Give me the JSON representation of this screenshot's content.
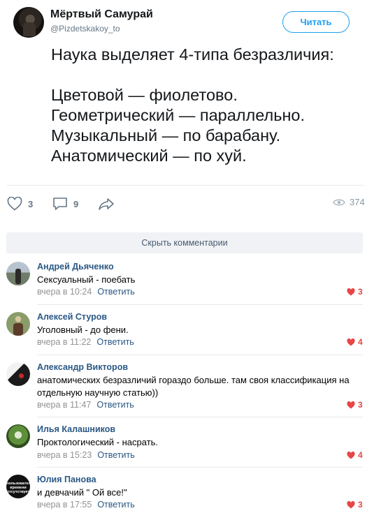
{
  "tweet": {
    "author_name": "Мёртвый Самурай",
    "author_handle": "@Pizdetskakoy_to",
    "follow_label": "Читать",
    "text_lines": [
      "Наука выделяет 4-типа безразличия:",
      "",
      "Цветовой — фиолетово.",
      "Геометрический — параллельно.",
      "Музыкальный — по барабану.",
      "Анатомический — по хуй."
    ],
    "likes": "3",
    "replies": "9",
    "views": "374",
    "icons": {
      "like": "heart-outline-icon",
      "reply": "comment-bubble-icon",
      "share": "share-arrow-icon",
      "views": "eye-icon"
    }
  },
  "comments_toggle_label": "Скрыть комментарии",
  "reply_label": "Ответить",
  "colors": {
    "link": "#2a5885",
    "like": "#e64646",
    "twitter_blue": "#1da1f2",
    "meta_gray": "#939393"
  },
  "comments": [
    {
      "author": "Андрей Дьяченко",
      "text": "Сексуальный - поебать",
      "time": "вчера в 10:24",
      "likes": "3"
    },
    {
      "author": "Алексей Стуров",
      "text": "Уголовный - до фени.",
      "time": "вчера в 11:22",
      "likes": "4"
    },
    {
      "author": "Александр Викторов",
      "text": "анатомических безразличий гораздо больше. там своя классификация на отдельную научную статью))",
      "time": "вчера в 11:47",
      "likes": "3"
    },
    {
      "author": "Илья Калашников",
      "text": "Проктологический - насрать.",
      "time": "вчера в 15:23",
      "likes": "4"
    },
    {
      "author": "Юлия Панова",
      "avatar_text": "пользователь времени отсутствует",
      "text": "и девчачий \" Ой все!\"",
      "time": "вчера в 17:55",
      "likes": "3"
    }
  ]
}
